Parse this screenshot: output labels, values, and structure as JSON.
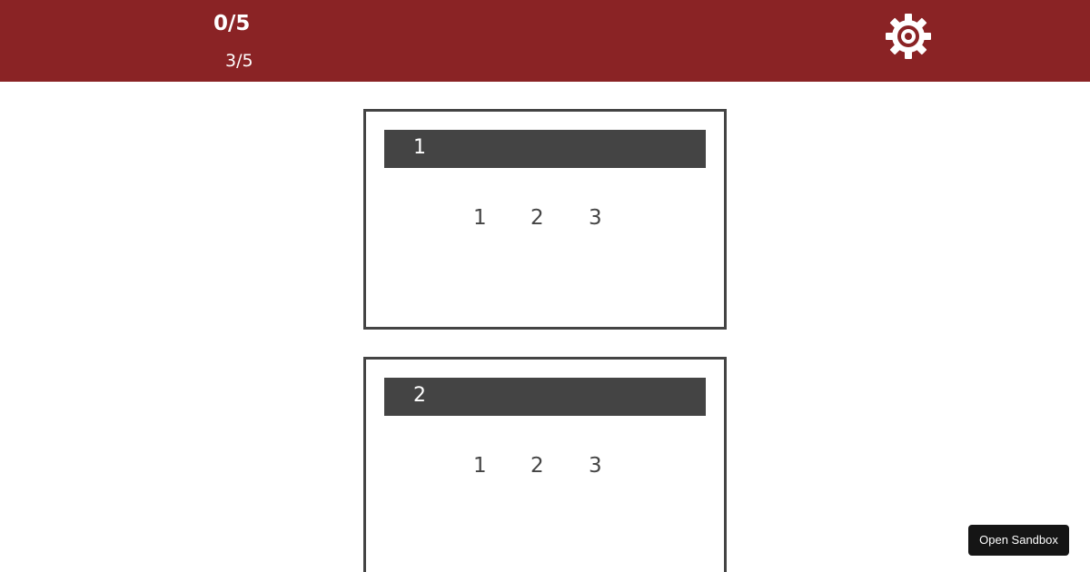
{
  "header": {
    "score_primary": "0/5",
    "score_secondary": "3/5",
    "settings_icon": "gear-icon",
    "background_color": "#8a2325",
    "text_color": "#ffffff"
  },
  "cards": [
    {
      "header_label": "1",
      "choices": [
        "1",
        "2",
        "3"
      ]
    },
    {
      "header_label": "2",
      "choices": [
        "1",
        "2",
        "3"
      ]
    }
  ],
  "sandbox": {
    "label": "Open Sandbox"
  },
  "colors": {
    "card_border": "#444444",
    "card_header": "#444444",
    "sandbox_button": "#151515"
  }
}
